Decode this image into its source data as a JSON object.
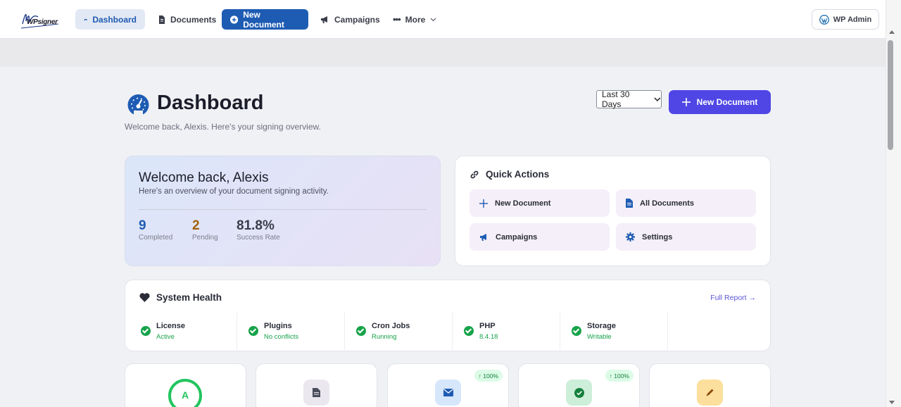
{
  "nav": {
    "logo_text": "WPsigner",
    "items": [
      {
        "label": "Dashboard"
      },
      {
        "label": "Documents"
      },
      {
        "label": "New Document"
      },
      {
        "label": "Campaigns"
      },
      {
        "label": "More"
      }
    ],
    "wp_admin": "WP Admin"
  },
  "header": {
    "title": "Dashboard",
    "subtitle": "Welcome back, Alexis. Here's your signing overview.",
    "range_selected": "Last 30 Days",
    "new_document": "New Document"
  },
  "welcome": {
    "title": "Welcome back, Alexis",
    "subtitle": "Here's an overview of your document signing activity.",
    "stats": [
      {
        "value": "9",
        "label": "Completed",
        "color": "#1e5cb3"
      },
      {
        "value": "2",
        "label": "Pending",
        "color": "#a16207"
      },
      {
        "value": "81.8%",
        "label": "Success Rate",
        "color": "#3a3d4a"
      }
    ]
  },
  "quick_actions": {
    "title": "Quick Actions",
    "items": [
      {
        "label": "New Document",
        "icon": "plus-icon"
      },
      {
        "label": "All Documents",
        "icon": "document-icon"
      },
      {
        "label": "Campaigns",
        "icon": "megaphone-icon"
      },
      {
        "label": "Settings",
        "icon": "gear-icon"
      }
    ]
  },
  "system_health": {
    "title": "System Health",
    "full_report": "Full Report →",
    "items": [
      {
        "name": "License",
        "status": "Active"
      },
      {
        "name": "Plugins",
        "status": "No conflicts"
      },
      {
        "name": "Cron Jobs",
        "status": "Running"
      },
      {
        "name": "PHP",
        "status": "8.4.18"
      },
      {
        "name": "Storage",
        "status": "Writable"
      }
    ]
  },
  "stat_cards": {
    "grade": "A",
    "sent_trend": "↑ 100%",
    "completed_trend": "↑ 100%"
  },
  "colors": {
    "primary": "#4f46e5",
    "nav_active": "#1e5cb3",
    "success": "#16a34a"
  }
}
